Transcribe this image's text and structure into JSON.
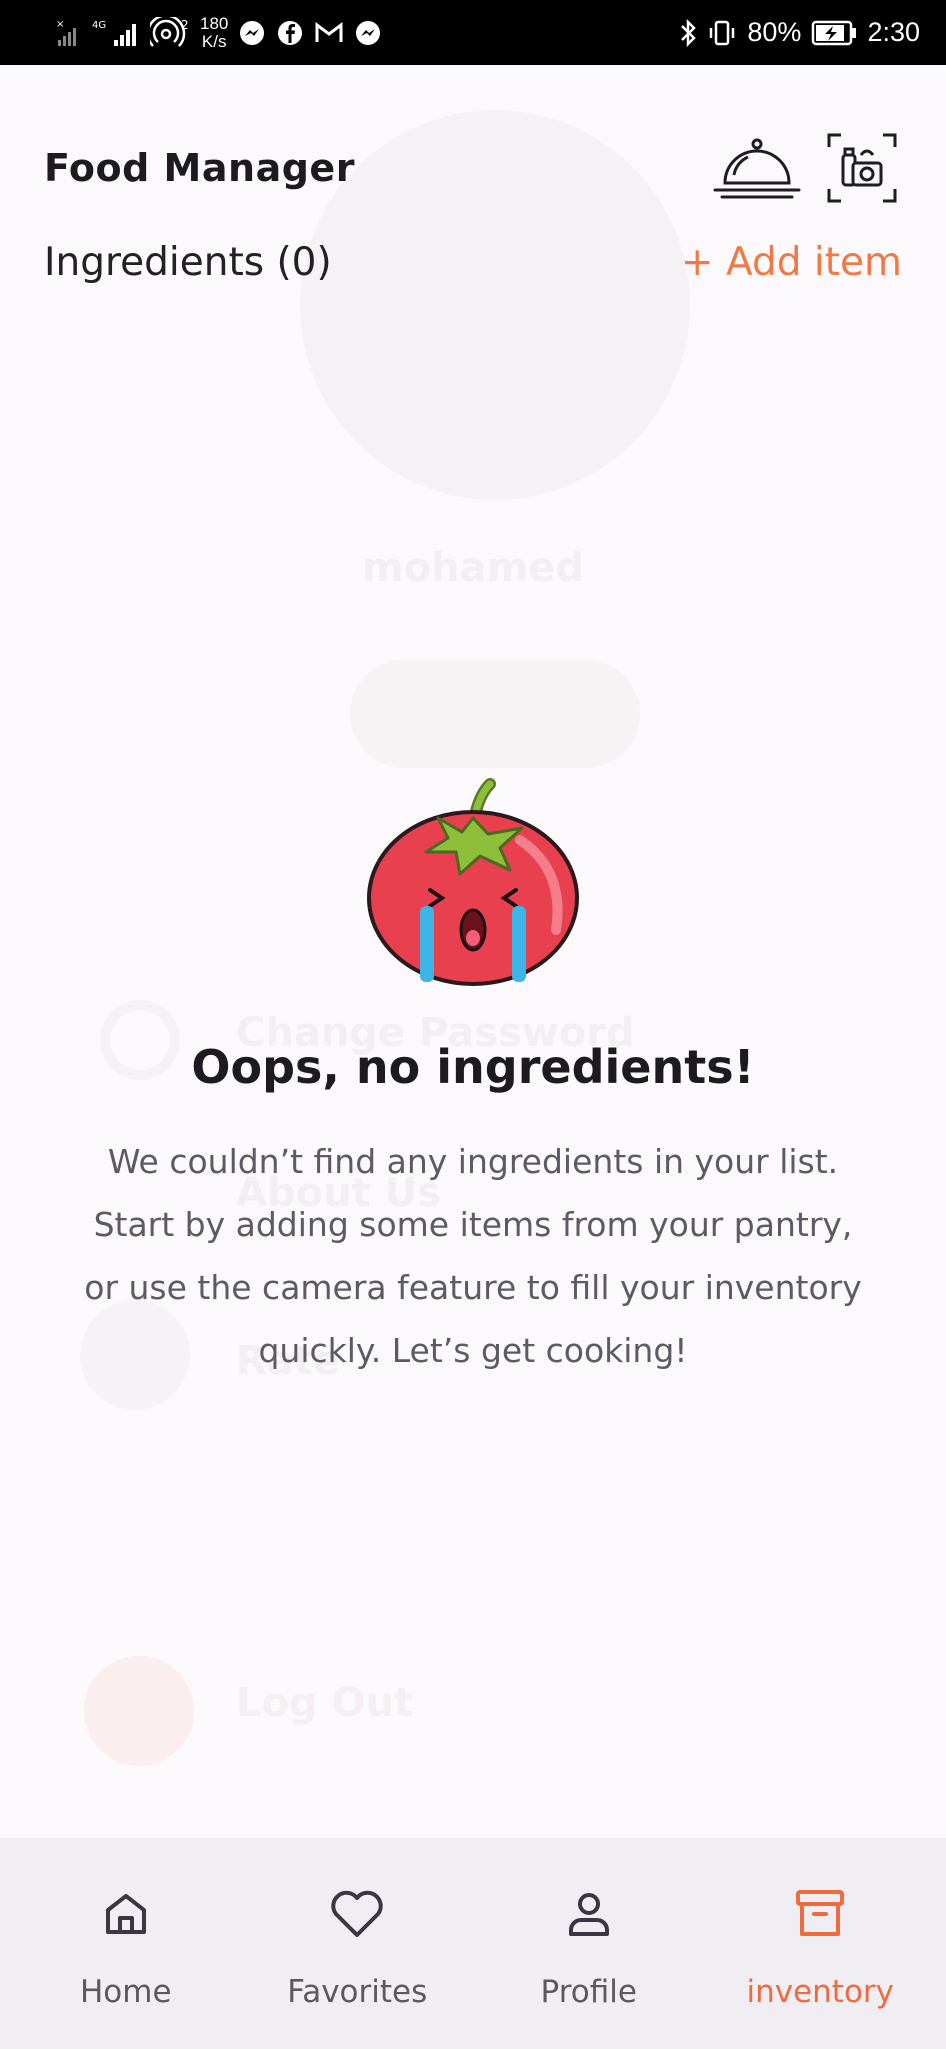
{
  "status_bar": {
    "net_type": "4G",
    "speed_value": "180",
    "speed_unit": "K/s",
    "battery": "80%",
    "time": "2:30"
  },
  "background_ghost": {
    "username": "mohamed",
    "change_password": "Change Password",
    "about_us": "About Us",
    "rate": "Rate",
    "log_out": "Log Out"
  },
  "header": {
    "title": "Food Manager",
    "cloche_icon": "cloche-icon",
    "scan_icon": "scan-camera-icon"
  },
  "list": {
    "label": "Ingredients (0)",
    "add_button": "+ Add item"
  },
  "empty_state": {
    "illustration": "crying-tomato",
    "title": "Oops, no ingredients!",
    "message": "We couldn’t find any ingredients in your list. Start by adding some items from your pantry, or use the camera feature to fill your inventory quickly. Let’s get cooking!"
  },
  "bottom_nav": {
    "items": [
      {
        "label": "Home",
        "icon": "home-icon",
        "active": false
      },
      {
        "label": "Favorites",
        "icon": "heart-icon",
        "active": false
      },
      {
        "label": "Profile",
        "icon": "person-icon",
        "active": false
      },
      {
        "label": "inventory",
        "icon": "archive-icon",
        "active": true
      }
    ]
  },
  "colors": {
    "accent": "#ef6a3f",
    "background": "#fcf9fc",
    "nav_background": "#f0eef2",
    "tomato_red": "#e8404f",
    "leaf_green": "#8dbf3a"
  }
}
